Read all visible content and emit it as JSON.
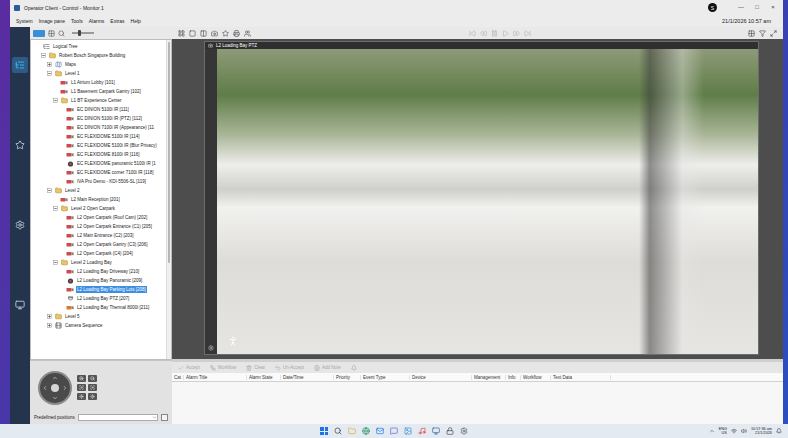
{
  "window": {
    "title": "Operator Client - Control - Monitor 1",
    "controls": [
      "—",
      "□",
      "×"
    ]
  },
  "menu": [
    "System",
    "Image pane",
    "Tools",
    "Alarms",
    "Extras",
    "Help"
  ],
  "user": {
    "initial": "S"
  },
  "datetime": "21/1/2026 10:57 am",
  "nav": [
    {
      "kind": "tree",
      "selected": true
    },
    {
      "kind": "favorites",
      "selected": false
    },
    {
      "kind": "settings",
      "selected": false
    },
    {
      "kind": "monitor",
      "selected": false
    }
  ],
  "tree_zoom": {
    "level": 0.25
  },
  "tree": [
    {
      "label": "Logical Tree",
      "level": 0,
      "kind": "root",
      "expanded": true,
      "selected": false
    },
    {
      "label": "Robert Bosch Singapore Building",
      "level": 1,
      "kind": "site",
      "expanded": true,
      "selected": false
    },
    {
      "label": "Maps",
      "level": 2,
      "kind": "map",
      "expanded": false,
      "selected": false
    },
    {
      "label": "Level 1",
      "level": 2,
      "kind": "folder",
      "expanded": true,
      "selected": false
    },
    {
      "label": "L1 Atrium Lobby [101]",
      "level": 3,
      "kind": "camera",
      "expanded": false,
      "selected": false
    },
    {
      "label": "L1 Basement Carpark Gantry [102]",
      "level": 3,
      "kind": "camera",
      "expanded": false,
      "selected": false
    },
    {
      "label": "L1 BT Experience Center",
      "level": 3,
      "kind": "folder",
      "expanded": true,
      "selected": false
    },
    {
      "label": "EC DINION 5100i IR [111]",
      "level": 4,
      "kind": "camera",
      "expanded": false,
      "selected": false
    },
    {
      "label": "EC DINION 5100i IR (PTZ) [112]",
      "level": 4,
      "kind": "camera",
      "expanded": false,
      "selected": false
    },
    {
      "label": "EC DINION 7100i IR (Appearance) [11",
      "level": 4,
      "kind": "camera",
      "expanded": false,
      "selected": false
    },
    {
      "label": "EC FLEXIDOME 5100i IR [114]",
      "level": 4,
      "kind": "camera",
      "expanded": false,
      "selected": false
    },
    {
      "label": "EC FLEXIDOME 5100i IR (Blur Privacy)",
      "level": 4,
      "kind": "camera",
      "expanded": false,
      "selected": false
    },
    {
      "label": "EC FLEXIDOME 8100i IR [116]",
      "level": 4,
      "kind": "camera",
      "expanded": false,
      "selected": false
    },
    {
      "label": "EC FLEXIDOME panoramic 5100i IR [1",
      "level": 4,
      "kind": "panoramic",
      "expanded": false,
      "selected": false
    },
    {
      "label": "EC FLEXIDOME corner 7100i IR [118]",
      "level": 4,
      "kind": "camera",
      "expanded": false,
      "selected": false
    },
    {
      "label": "IVA Pro Demo - KDI-5506-SL [119]",
      "level": 4,
      "kind": "camera",
      "expanded": false,
      "selected": false
    },
    {
      "label": "Level 2",
      "level": 2,
      "kind": "folder",
      "expanded": true,
      "selected": false
    },
    {
      "label": "L2 Main Reception [201]",
      "level": 3,
      "kind": "camera",
      "expanded": false,
      "selected": false
    },
    {
      "label": "Level 2 Open Carpark",
      "level": 3,
      "kind": "folder",
      "expanded": true,
      "selected": false
    },
    {
      "label": "L2 Open Carpark (Roof Cam) [202]",
      "level": 4,
      "kind": "camera",
      "expanded": false,
      "selected": false
    },
    {
      "label": "L2 Open Carpark Entrance (C1) [205]",
      "level": 4,
      "kind": "camera",
      "expanded": false,
      "selected": false
    },
    {
      "label": "L2 Main Entrance (C2) [203]",
      "level": 4,
      "kind": "camera",
      "expanded": false,
      "selected": false
    },
    {
      "label": "L2 Open Carpark Gantry (C3) [206]",
      "level": 4,
      "kind": "camera",
      "expanded": false,
      "selected": false
    },
    {
      "label": "L2 Open Carpark (C4) [204]",
      "level": 4,
      "kind": "camera",
      "expanded": false,
      "selected": false
    },
    {
      "label": "Level 2 Loading Bay",
      "level": 3,
      "kind": "folder",
      "expanded": true,
      "selected": false
    },
    {
      "label": "L2 Loading Bay Driveway [210]",
      "level": 4,
      "kind": "camera",
      "expanded": false,
      "selected": false
    },
    {
      "label": "L2 Loading Bay Panoramic [209]",
      "level": 4,
      "kind": "panoramic",
      "expanded": false,
      "selected": false
    },
    {
      "label": "L2 Loading Bay Parking Lots [208]",
      "level": 4,
      "kind": "camera",
      "expanded": false,
      "selected": true
    },
    {
      "label": "L2 Loading Bay PTZ [207]",
      "level": 4,
      "kind": "ptz",
      "expanded": false,
      "selected": false
    },
    {
      "label": "L2 Loading Bay Thermal 8000i [211]",
      "level": 4,
      "kind": "thermal",
      "expanded": false,
      "selected": false
    },
    {
      "label": "Level 5",
      "level": 2,
      "kind": "folder",
      "expanded": false,
      "selected": false
    },
    {
      "label": "Camera Sequence",
      "level": 2,
      "kind": "sequence",
      "expanded": false,
      "selected": false
    }
  ],
  "image_pane": {
    "title": "L2 Loading Bay PTZ"
  },
  "ptz": {
    "label": "Predefined positions"
  },
  "alarms": {
    "actions": [
      {
        "label": "Accept",
        "disabled": true
      },
      {
        "label": "Workflow",
        "disabled": true
      },
      {
        "label": "Clear",
        "disabled": true
      },
      {
        "label": "Un-Accept",
        "disabled": true
      },
      {
        "label": "Add Note",
        "disabled": true
      }
    ],
    "columns": [
      "Cat",
      "Alarm Title",
      "Alarm State",
      "Date/Time",
      "Priority",
      "Event Type",
      "Device",
      "Management",
      "Info",
      "Workflow",
      "Text Data"
    ],
    "rows": []
  },
  "taskbar": {
    "language": "ENG",
    "region": "US",
    "time": "10:57:36 am",
    "date": "21/1/2026"
  }
}
